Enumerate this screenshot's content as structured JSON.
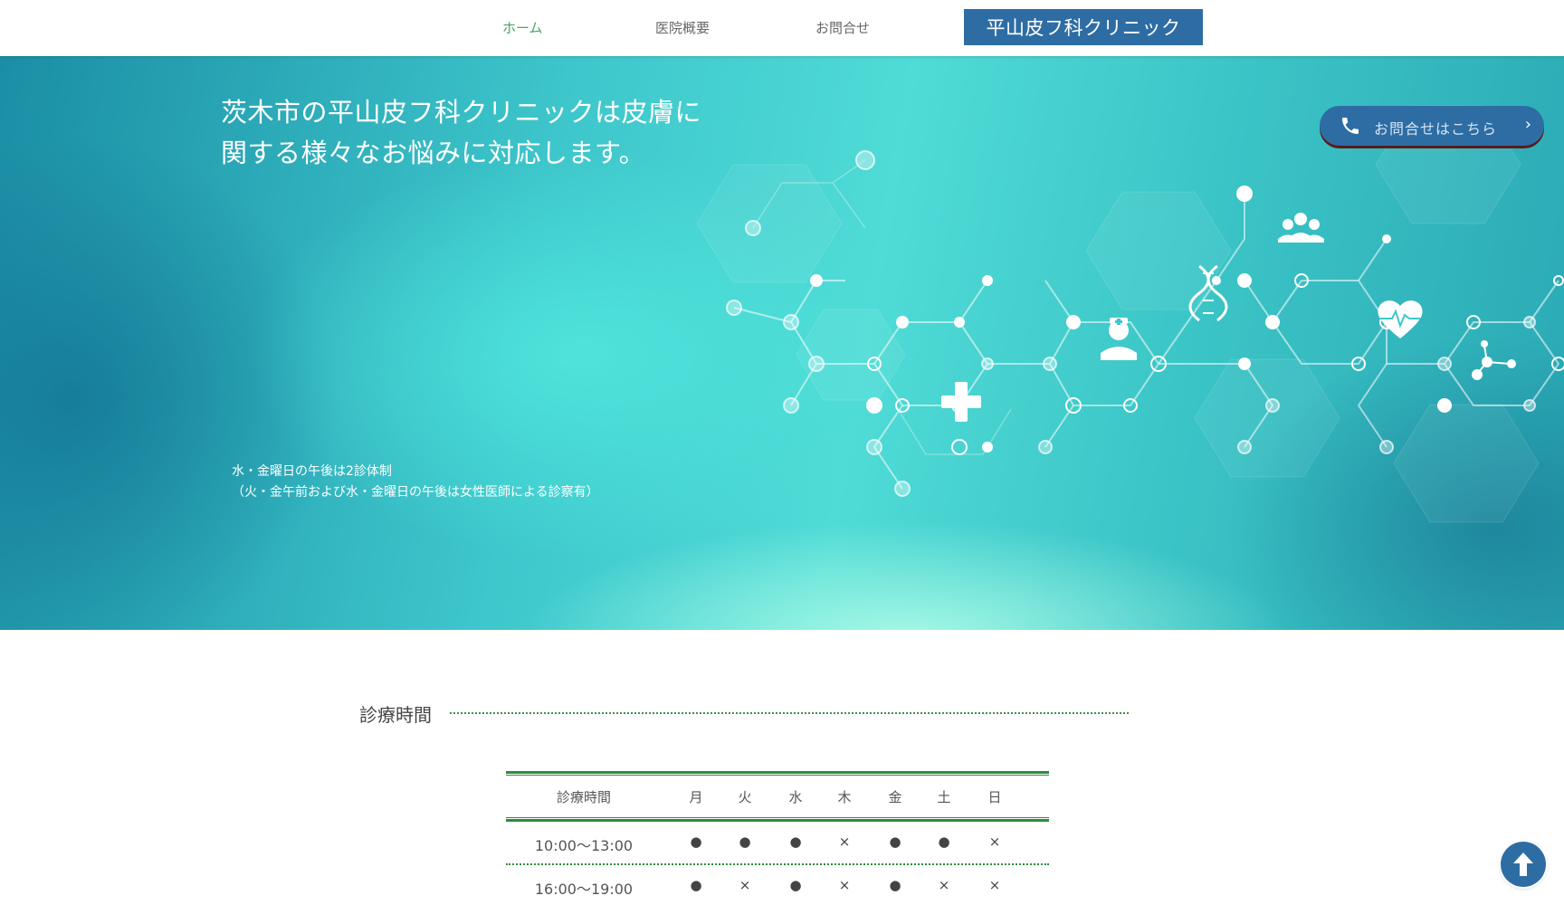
{
  "nav": {
    "items": [
      {
        "label": "ホーム"
      },
      {
        "label": "医院概要"
      },
      {
        "label": "お問合せ"
      }
    ],
    "brand": "平山皮フ科クリニック"
  },
  "hero": {
    "title_lines": [
      "茨木市の平山皮フ科クリニックは皮膚に",
      "関する様々なお悩みに対応します。"
    ],
    "note_lines": [
      "水・金曜日の午後は2診体制",
      "（火・金午前および水・金曜日の午後は女性医師による診察有）"
    ],
    "contact_button": "お問合せはこちら",
    "icons": [
      "medical-cross-icon",
      "nurse-icon",
      "dna-icon",
      "medical-team-icon",
      "heart-pulse-icon",
      "molecule-icon"
    ]
  },
  "hours": {
    "section_title": "診療時間",
    "header": [
      "診療時間",
      "月",
      "火",
      "水",
      "木",
      "金",
      "土",
      "日"
    ],
    "rows": [
      [
        "10:00～13:00",
        "●",
        "●",
        "●",
        "×",
        "●",
        "●",
        "×"
      ],
      [
        "16:00～19:00",
        "●",
        "×",
        "●",
        "×",
        "●",
        "×",
        "×"
      ]
    ]
  },
  "colors": {
    "accent_blue": "#2e6da4",
    "nav_active_green": "#4aa564",
    "rule_green": "#2e8b3e"
  },
  "scroll_top_icon": "arrow-up-icon",
  "contact_icon": "phone-icon"
}
